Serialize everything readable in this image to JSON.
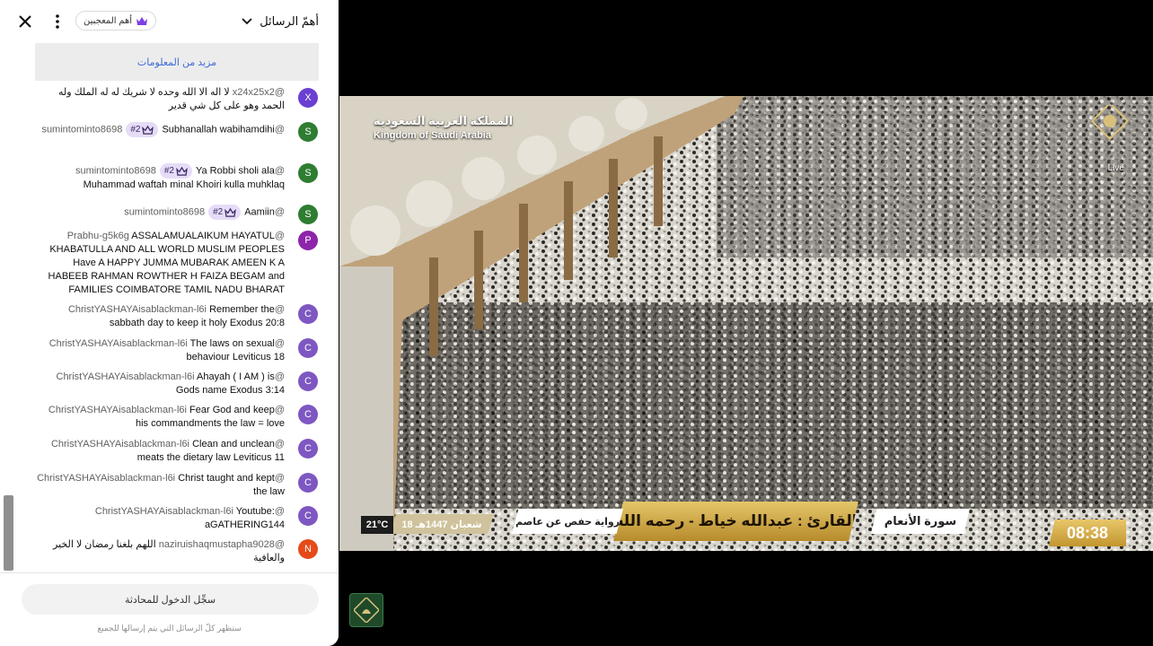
{
  "chat": {
    "title": "أهمّ الرسائل",
    "top_supporters_label": "أهم المعجبين",
    "more_info_link": "مزيد من المعلومات",
    "signin_label": "سجِّل الدخول للمحادثة",
    "footer_note": "ستظهر كلّ الرسائل التي يتم إرسالها للجميع",
    "messages": [
      {
        "author": "@x24x25x2",
        "initial": "X",
        "color": "#6a3fd1",
        "badge": "",
        "text": "لا اله الا الله وحده لا شريك له له الملك وله الحمد وهو على كل شي قدير"
      },
      {
        "author": "@sumintominto8698",
        "initial": "S",
        "color": "#2e7d32",
        "badge": "#2",
        "text": "Subhanallah wabihamdihi"
      },
      {
        "author": "@sumintominto8698",
        "initial": "S",
        "color": "#2e7d32",
        "badge": "#2",
        "text": "Ya Robbi sholi ala Muhammad waftah minal Khoiri kulla muhklaq"
      },
      {
        "author": "@sumintominto8698",
        "initial": "S",
        "color": "#2e7d32",
        "badge": "#2",
        "text": "Aamiin"
      },
      {
        "author": "@Prabhu-g5k6g",
        "initial": "P",
        "color": "#8e24aa",
        "badge": "",
        "text": "ASSALAMUALAIKUM HAYATUL KHABATULLA AND ALL WORLD MUSLIM PEOPLES Have A HAPPY JUMMA MUBARAK AMEEN K A HABEEB RAHMAN ROWTHER H FAIZA BEGAM and FAMILIES COIMBATORE TAMIL NADU BHARAT"
      },
      {
        "author": "@ChristYASHAYAisablackman-l6i",
        "initial": "C",
        "color": "#7e57c2",
        "badge": "",
        "text": "Remember the sabbath day to keep it holy Exodus 20:8"
      },
      {
        "author": "@ChristYASHAYAisablackman-l6i",
        "initial": "C",
        "color": "#7e57c2",
        "badge": "",
        "text": "The laws on sexual behaviour Leviticus 18"
      },
      {
        "author": "@ChristYASHAYAisablackman-l6i",
        "initial": "C",
        "color": "#7e57c2",
        "badge": "",
        "text": "Ahayah ( I AM ) is Gods name Exodus 3:14"
      },
      {
        "author": "@ChristYASHAYAisablackman-l6i",
        "initial": "C",
        "color": "#7e57c2",
        "badge": "",
        "text": "Fear God and keep his commandments the law = love"
      },
      {
        "author": "@ChristYASHAYAisablackman-l6i",
        "initial": "C",
        "color": "#7e57c2",
        "badge": "",
        "text": "Clean and unclean meats the dietary law Leviticus 11"
      },
      {
        "author": "@ChristYASHAYAisablackman-l6i",
        "initial": "C",
        "color": "#7e57c2",
        "badge": "",
        "text": "Christ taught and kept the law"
      },
      {
        "author": "@ChristYASHAYAisablackman-l6i",
        "initial": "C",
        "color": "#7e57c2",
        "badge": "",
        "text": "Youtube: aGATHERING144"
      },
      {
        "author": "@naziruishaqmustapha9028",
        "initial": "N",
        "color": "#e64a19",
        "badge": "",
        "text": "اللهم بلغنا رمضان لا الخير والعافية"
      }
    ]
  },
  "video": {
    "channel_ar": "المملكة العربية السعودية",
    "channel_en": "Kingdom of Saudi Arabia",
    "live_label": "Live",
    "reciter": "القارئ : عبدالله خياط - رحمه الله",
    "surah": "سورة الأنعام",
    "riwaya": "رواية حفص عن عاصم",
    "date": "18 شعبان 1447هـ",
    "temperature": "21°C",
    "time": "08:38"
  },
  "icons": {
    "close": "close-icon",
    "menu": "more-vert-icon",
    "crown": "crown-icon",
    "dropdown": "chevron-down-icon"
  },
  "colors": {
    "badge_bg": "#e6dcf7",
    "crown": "#7b3fe4",
    "link": "#3f6ad8",
    "gold": "#c9a03e"
  }
}
